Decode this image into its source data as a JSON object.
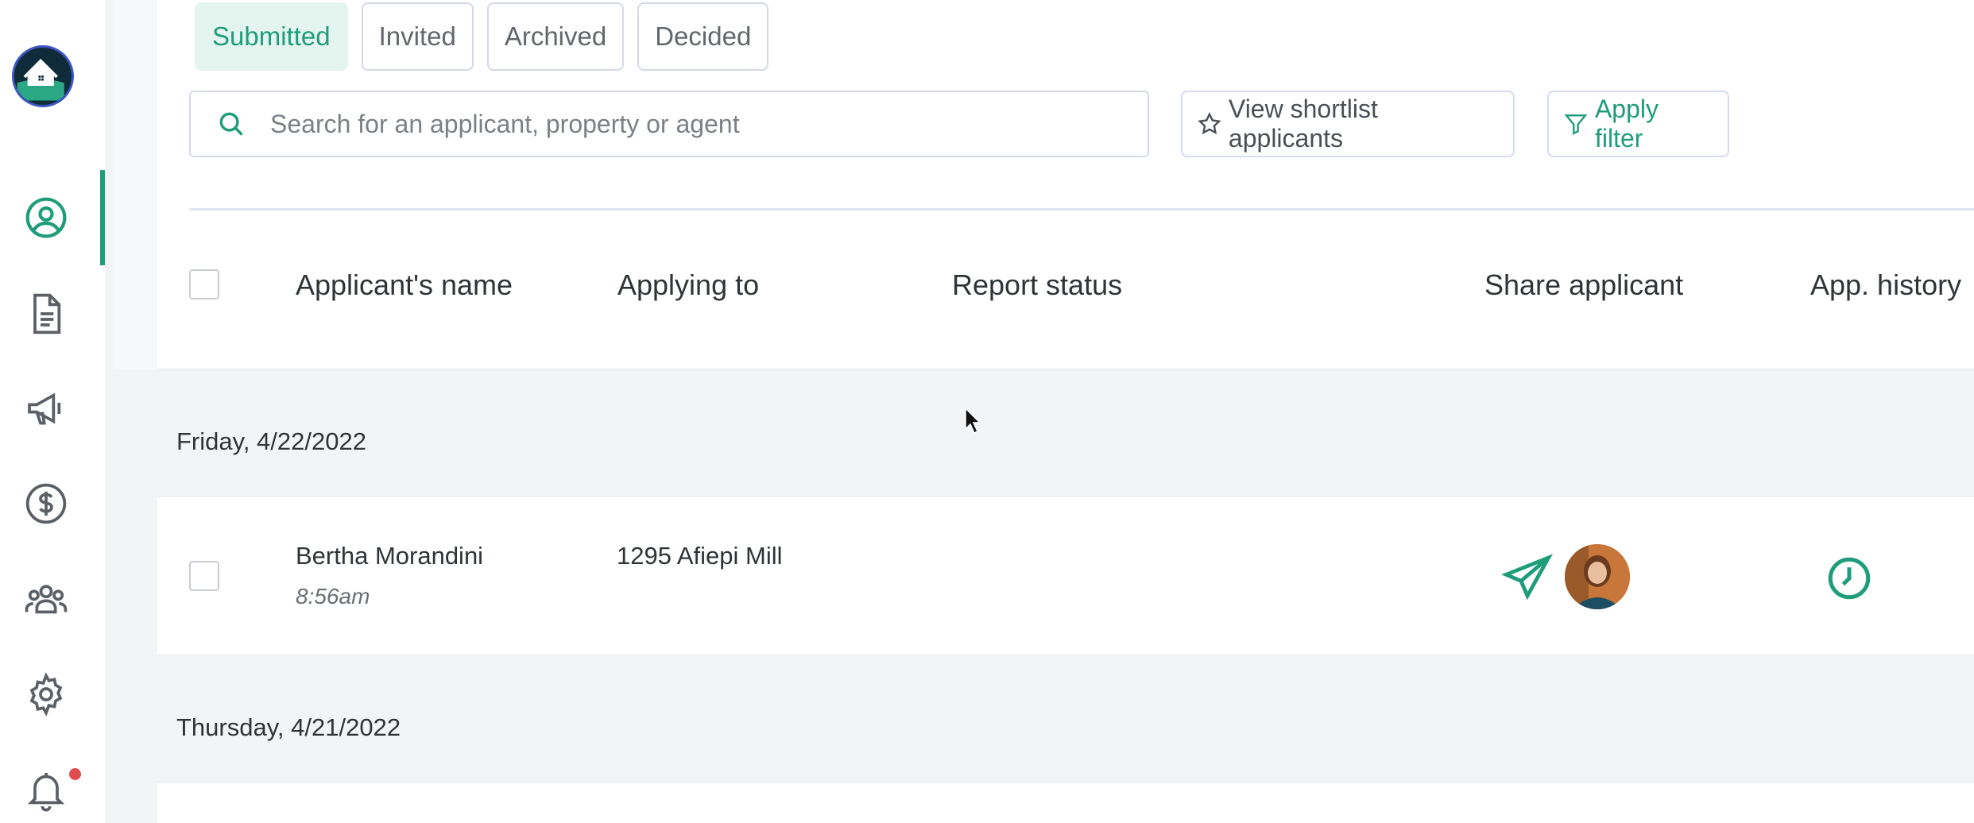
{
  "tabs": [
    {
      "label": "Submitted",
      "active": true
    },
    {
      "label": "Invited",
      "active": false
    },
    {
      "label": "Archived",
      "active": false
    },
    {
      "label": "Decided",
      "active": false
    }
  ],
  "search": {
    "placeholder": "Search for an applicant, property or agent",
    "value": ""
  },
  "toolbar": {
    "shortlist_label": "View shortlist applicants",
    "filter_label": "Apply filter"
  },
  "table": {
    "headers": {
      "name": "Applicant's name",
      "applying_to": "Applying to",
      "report_status": "Report status",
      "share": "Share applicant",
      "history": "App. history"
    }
  },
  "groups": [
    {
      "date": "Friday, 4/22/2022",
      "rows": [
        {
          "name": "Bertha Morandini",
          "time": "8:56am",
          "applying_to": "1295 Afiepi Mill"
        }
      ]
    },
    {
      "date": "Thursday, 4/21/2022",
      "rows": []
    }
  ],
  "colors": {
    "accent": "#1f9d7a",
    "notification": "#e24b4b",
    "logo_ring": "#3d56c2"
  },
  "sidebar": {
    "items": [
      {
        "icon": "user-circle-icon",
        "active": true
      },
      {
        "icon": "document-icon",
        "active": false
      },
      {
        "icon": "megaphone-icon",
        "active": false
      },
      {
        "icon": "dollar-circle-icon",
        "active": false
      },
      {
        "icon": "group-icon",
        "active": false
      },
      {
        "icon": "gear-icon",
        "active": false
      },
      {
        "icon": "bell-icon",
        "active": false,
        "has_notification": true
      }
    ]
  }
}
